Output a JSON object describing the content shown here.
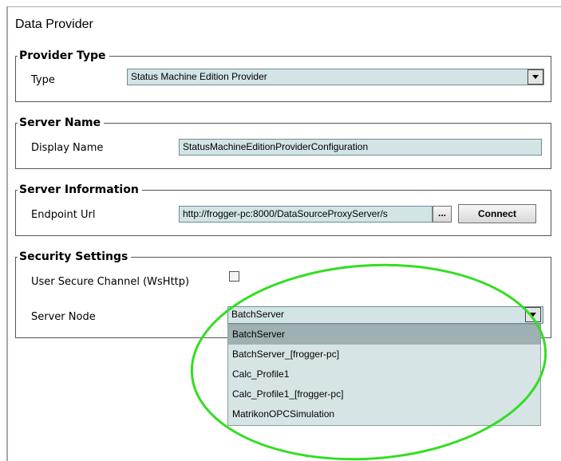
{
  "panel": {
    "title": "Data Provider"
  },
  "provider_type": {
    "legend": "Provider Type",
    "type_label": "Type",
    "type_value": "Status Machine Edition Provider"
  },
  "server_name": {
    "legend": "Server Name",
    "display_name_label": "Display Name",
    "display_name_value": "StatusMachineEditionProviderConfiguration"
  },
  "server_information": {
    "legend": "Server Information",
    "endpoint_label": "Endpoint Url",
    "endpoint_value": "http://frogger-pc:8000/DataSourceProxyServer/s",
    "browse_label": "...",
    "connect_label": "Connect"
  },
  "security": {
    "legend": "Security Settings",
    "secure_channel_label": "User Secure Channel (WsHttp)",
    "secure_channel_checked": false,
    "server_node_label": "Server Node",
    "server_node_value": "BatchServer",
    "options": [
      "BatchServer",
      "BatchServer_[frogger-pc]",
      "Calc_Profile1",
      "Calc_Profile1_[frogger-pc]",
      "MatrikonOPCSimulation"
    ],
    "highlighted_option": "BatchServer"
  },
  "annotation": {
    "color": "#33dd22"
  }
}
